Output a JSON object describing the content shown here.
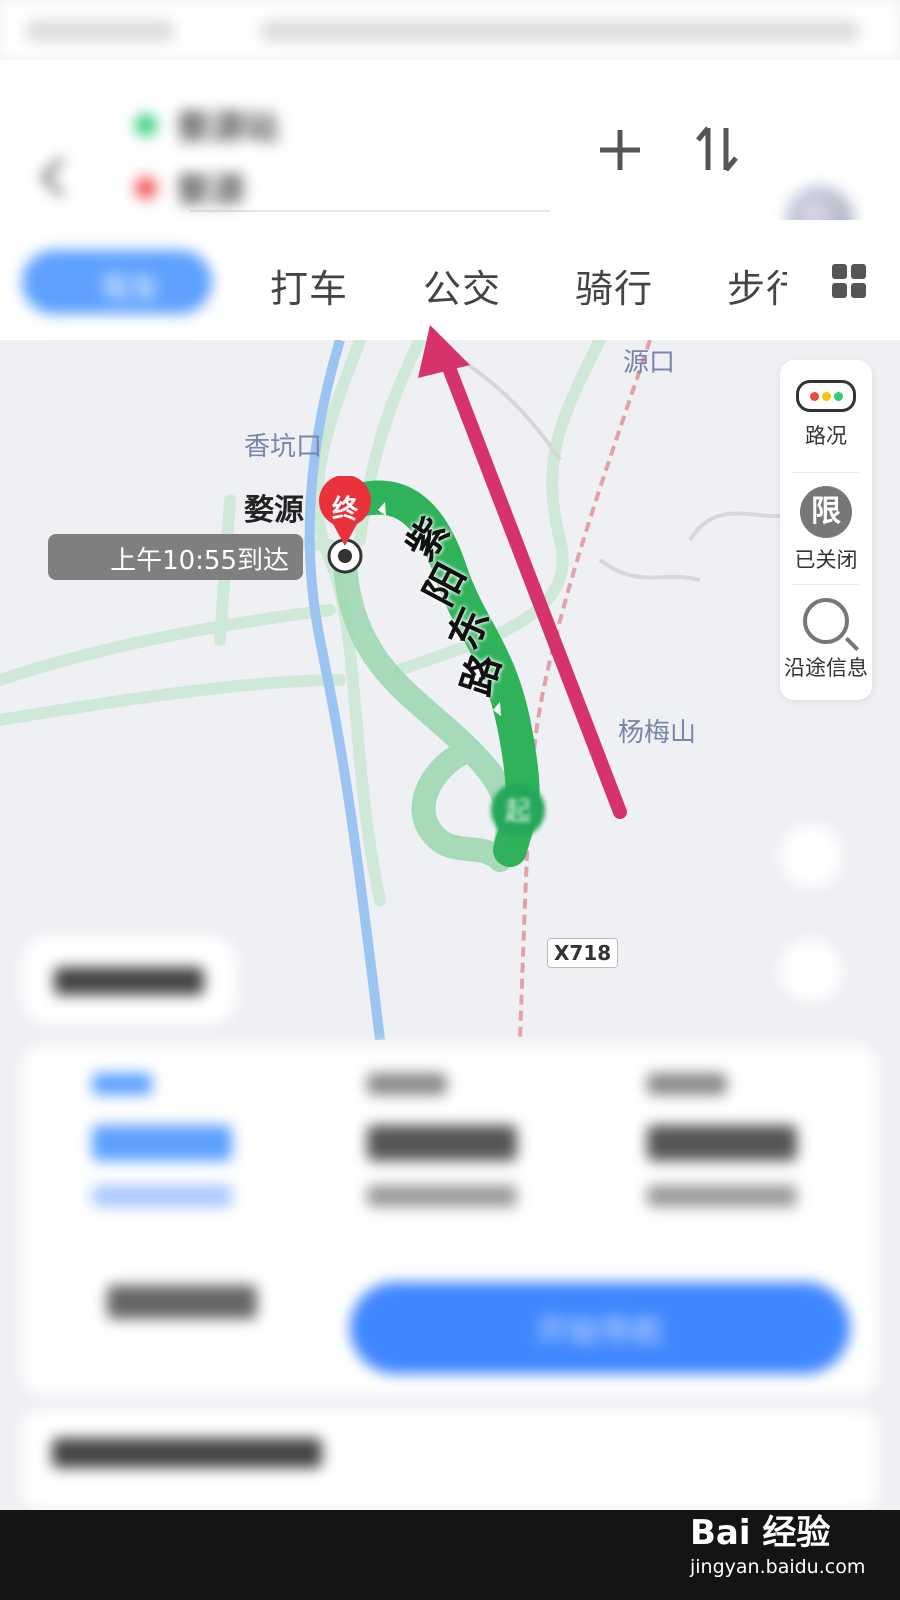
{
  "header": {
    "origin": "婺源站",
    "destination": "婺源",
    "add_icon": "plus-icon",
    "swap_icon": "swap-icon"
  },
  "tabs": {
    "active": "驾车",
    "items": [
      "打车",
      "公交",
      "骑行",
      "步行"
    ]
  },
  "map": {
    "labels": [
      "源口",
      "香坑口",
      "杨梅山"
    ],
    "destination_label": "婺源",
    "end_marker": "终",
    "start_marker": "起",
    "eta": "上午10:55到达",
    "road_name": [
      "紫",
      "阳",
      "东",
      "路"
    ],
    "road_badge": "X718"
  },
  "side_panel": {
    "traffic": "路况",
    "restriction_icon_char": "限",
    "restriction": "已关闭",
    "along_route": "沿途信息"
  },
  "plans": {
    "start_navigation": "开始导航"
  },
  "watermark": {
    "brand": "Bai 经验",
    "url": "jingyan.baidu.com"
  },
  "colors": {
    "accent": "#3f86ff",
    "route_green": "#2fb25a",
    "annotation_arrow": "#d6336c",
    "end_marker": "#e8323c"
  }
}
